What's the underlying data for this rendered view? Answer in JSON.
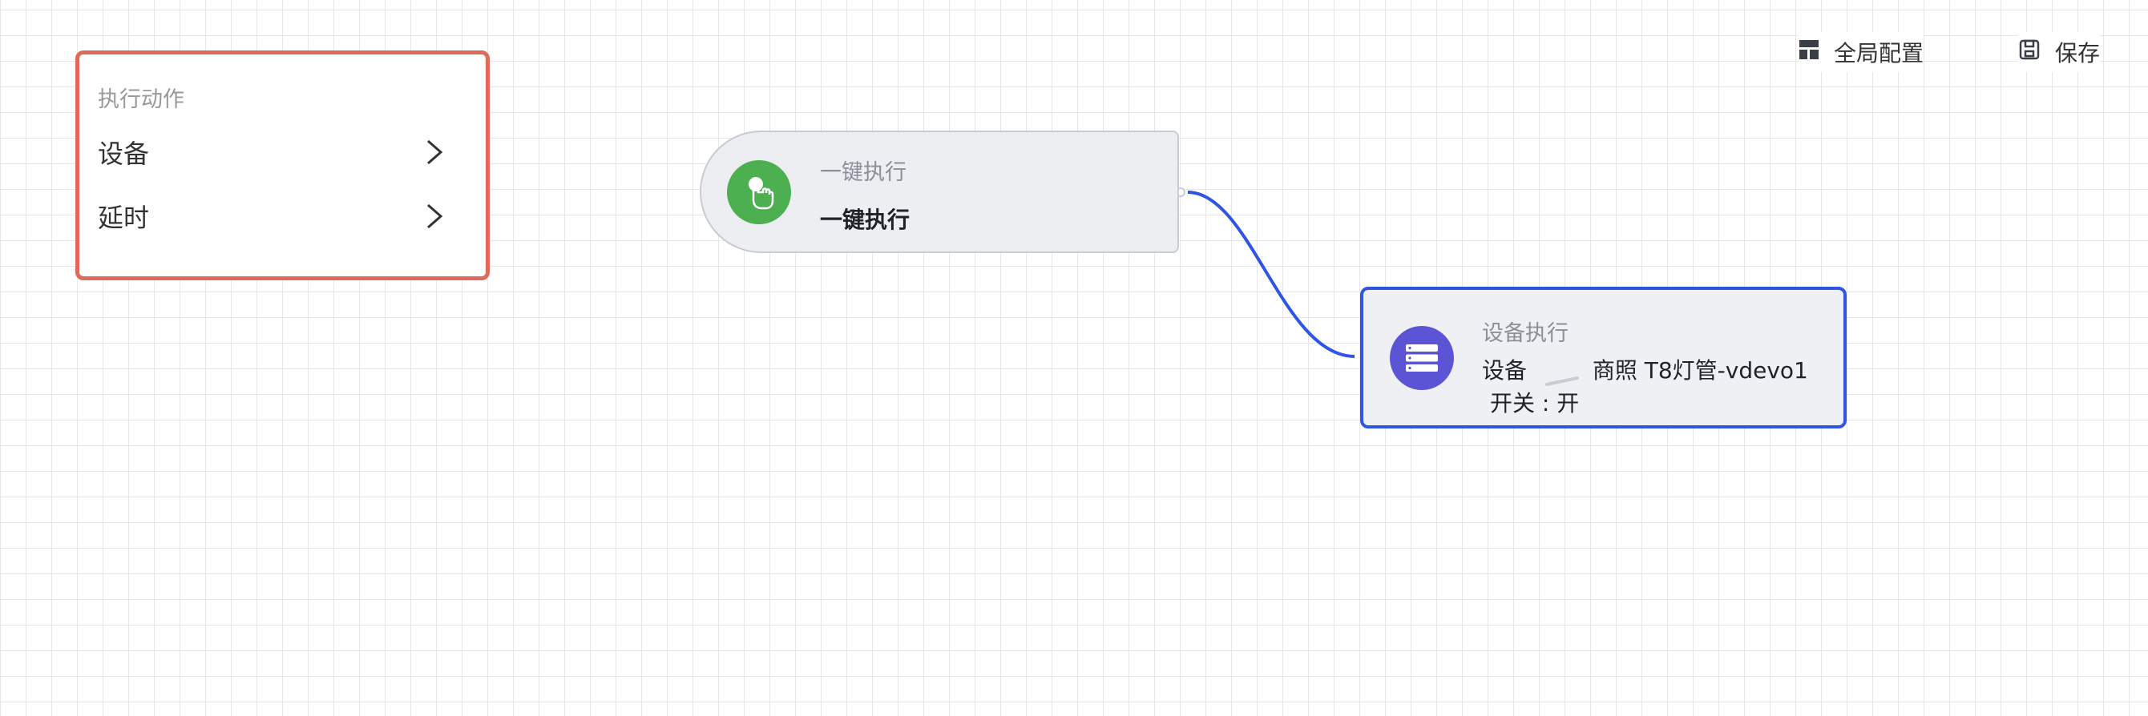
{
  "panel": {
    "title": "执行动作",
    "items": [
      {
        "label": "设备"
      },
      {
        "label": "延时"
      }
    ]
  },
  "toolbar": {
    "global_config_label": "全局配置",
    "save_label": "保存"
  },
  "nodes": {
    "trigger": {
      "subtitle": "一键执行",
      "title": "一键执行",
      "icon": "tap-hand-icon",
      "color": "#4caf50"
    },
    "action": {
      "subtitle": "设备执行",
      "device_prefix": "设备",
      "device_name": "商照 T8灯管-vdevo1",
      "state": "开关 : 开",
      "icon": "server-stack-icon",
      "color": "#5b55d6"
    }
  },
  "colors": {
    "panel_border": "#e06a5a",
    "action_border": "#2f55e4",
    "edge": "#2f55e4"
  }
}
